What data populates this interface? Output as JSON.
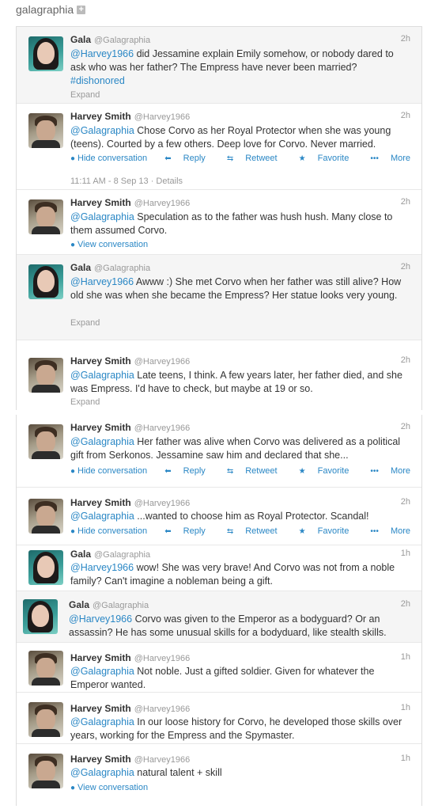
{
  "header": {
    "username": "galagraphia",
    "expand_icon": "plus-square-icon"
  },
  "colors": {
    "link": "#2a87c5",
    "meta": "#999999",
    "highlight": "#f5f5f5"
  },
  "tweets": [
    {
      "name": "Gala",
      "handle": "@Galagraphia",
      "time": "2h",
      "mention": "@Harvey1966",
      "text": " did Jessamine explain Emily somehow, or nobody dared to ask who was her father? The Empress have never been married?",
      "hashtag": "#dishonored",
      "footer": "Expand"
    },
    {
      "name": "Harvey Smith",
      "handle": "@Harvey1966",
      "time": "2h",
      "mention": "@Galagraphia",
      "text": " Chose Corvo as her Royal Protector when she was young (teens). Courted by a few others. Deep love for Corvo. Never married.",
      "conversation": "Hide conversation",
      "reply": "Reply",
      "retweet": "Retweet",
      "favorite": "Favorite",
      "more": "More",
      "timestamp": "11:11 AM - 8 Sep 13 · Details"
    },
    {
      "name": "Harvey Smith",
      "handle": "@Harvey1966",
      "time": "2h",
      "mention": "@Galagraphia",
      "text": " Speculation as to the father was hush hush. Many close to them assumed Corvo.",
      "conversation": "View conversation"
    },
    {
      "name": "Gala",
      "handle": "@Galagraphia",
      "time": "2h",
      "mention": "@Harvey1966",
      "text": " Awww :) She met Corvo when her father was still alive? How old she was when she became the Empress? Her statue looks very young.",
      "footer": "Expand"
    },
    {
      "name": "Harvey Smith",
      "handle": "@Harvey1966",
      "time": "2h",
      "mention": "@Galagraphia",
      "text": " Late teens, I think. A few years later, her father died, and she was Empress. I'd have to check, but maybe at 19 or so.",
      "footer": "Expand"
    },
    {
      "name": "Harvey Smith",
      "handle": "@Harvey1966",
      "time": "2h",
      "mention": "@Galagraphia",
      "text": " Her father was alive when Corvo was delivered as a political gift from Serkonos. Jessamine saw him and declared that she...",
      "conversation": "Hide conversation",
      "reply": "Reply",
      "retweet": "Retweet",
      "favorite": "Favorite",
      "more": "More"
    },
    {
      "name": "Harvey Smith",
      "handle": "@Harvey1966",
      "time": "2h",
      "mention": "@Galagraphia",
      "text": " ...wanted to choose him as Royal Protector. Scandal!",
      "conversation": "Hide conversation",
      "reply": "Reply",
      "retweet": "Retweet",
      "favorite": "Favorite",
      "more": "More"
    },
    {
      "name": "Gala",
      "handle": "@Galagraphia",
      "time": "1h",
      "mention": "@Harvey1966",
      "text": " wow! She was very brave! And Corvo was not from a noble family? Can't imagine a nobleman being a gift."
    },
    {
      "name": "Gala",
      "handle": "@Galagraphia",
      "time": "2h",
      "mention": "@Harvey1966",
      "text": " Corvo was given to the Emperor as a bodyguard? Or an assassin? He has some unusual skills for a bodyduard, like stealth skills."
    },
    {
      "name": "Harvey Smith",
      "handle": "@Harvey1966",
      "time": "1h",
      "mention": "@Galagraphia",
      "text": " Not noble. Just a gifted soldier. Given for whatever the Emperor wanted."
    },
    {
      "name": "Harvey Smith",
      "handle": "@Harvey1966",
      "time": "1h",
      "mention": "@Galagraphia",
      "text": " In our loose history for Corvo, he developed those skills over years, working for the Empress and the Spymaster."
    },
    {
      "name": "Harvey Smith",
      "handle": "@Harvey1966",
      "time": "1h",
      "mention": "@Galagraphia",
      "text": " natural talent + skill",
      "conversation": "View conversation"
    }
  ]
}
